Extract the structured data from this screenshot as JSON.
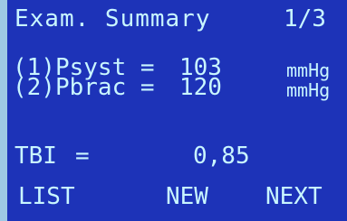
{
  "header": {
    "title": "Exam. Summary",
    "page": "1/3"
  },
  "measurements": [
    {
      "label": "(1)Psyst =",
      "value": "103",
      "unit": "mmHg"
    },
    {
      "label": "(2)Pbrac =",
      "value": "120",
      "unit": "mmHg"
    }
  ],
  "result": {
    "label": "TBI",
    "equals": "=",
    "value": "0,85"
  },
  "softkeys": {
    "list": "LIST",
    "new": "NEW",
    "next": "NEXT"
  },
  "colors": {
    "screen_background": "#1d33b8",
    "text": "#c9f6ff",
    "frame": "#9ec9e4"
  }
}
